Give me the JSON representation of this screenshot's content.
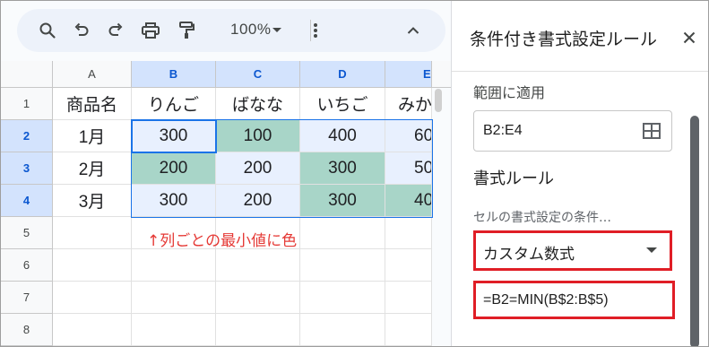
{
  "toolbar": {
    "zoom": "100%",
    "icons": [
      "search-icon",
      "undo-icon",
      "redo-icon",
      "print-icon",
      "paint-format-icon",
      "chevron-down-icon",
      "more-vert-icon",
      "chevron-up-icon"
    ]
  },
  "sheet": {
    "column_headers": [
      "A",
      "B",
      "C",
      "D",
      "E"
    ],
    "row_headers": [
      "1",
      "2",
      "3",
      "4",
      "5",
      "6",
      "7",
      "8"
    ],
    "rows": [
      [
        "商品名",
        "りんご",
        "ばなな",
        "いちご",
        "みか"
      ],
      [
        "1月",
        "300",
        "100",
        "400",
        "60"
      ],
      [
        "2月",
        "200",
        "200",
        "300",
        "50"
      ],
      [
        "3月",
        "300",
        "200",
        "300",
        "40"
      ]
    ],
    "note": "↑列ごとの最小値に色",
    "colors": {
      "highlight": "#a8d5c8",
      "range_fill": "#e8f0fe",
      "selection": "#1a73e8",
      "note_text": "#e53935"
    }
  },
  "sidebar": {
    "title": "条件付き書式設定ルール",
    "apply_to_label": "範囲に適用",
    "range_value": "B2:E4",
    "rules_heading": "書式ルール",
    "condition_label": "セルの書式設定の条件…",
    "condition_value": "カスタム数式",
    "formula_value": "=B2=MIN(B$2:B$5)",
    "highlight_box_color": "#e01e26"
  }
}
